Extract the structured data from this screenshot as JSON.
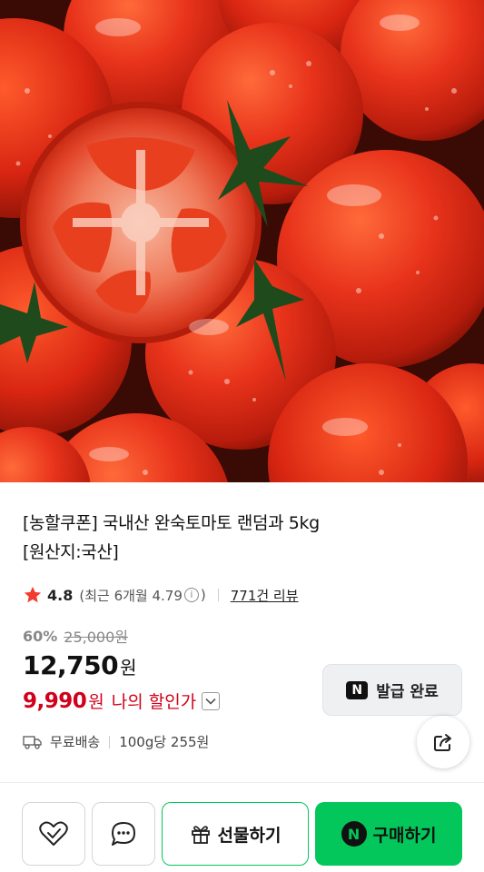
{
  "product": {
    "image_icon": "product-photo-tomatoes",
    "title_line1": "[농할쿠폰] 국내산 완숙토마토 랜덤과 5kg",
    "title_line2": "[원산지:국산]"
  },
  "rating": {
    "star_icon": "star-icon",
    "value": "4.8",
    "recent_text": "(최근 6개월 4.79",
    "info_symbol": "i",
    "recent_close": ")",
    "review_link": "771건 리뷰"
  },
  "price": {
    "discount_rate": "60%",
    "original": "25,000원",
    "sale": "12,750",
    "sale_unit": "원",
    "my_price": "9,990",
    "my_price_unit": "원",
    "my_price_label": "나의 할인가"
  },
  "coupon": {
    "badge": "N",
    "label": "발급 완료"
  },
  "delivery": {
    "icon": "truck-icon",
    "label": "무료배송",
    "unit_price": "100g당 255원"
  },
  "actions": {
    "wish_icon": "heart-check-icon",
    "chat_icon": "chat-bubble-icon",
    "share_icon": "share-icon",
    "gift_icon": "gift-icon",
    "gift_label": "선물하기",
    "buy_badge": "N",
    "buy_label": "구매하기"
  },
  "colors": {
    "naver_green": "#03c75a",
    "price_red": "#d0021b",
    "star_red": "#f33a2f"
  }
}
